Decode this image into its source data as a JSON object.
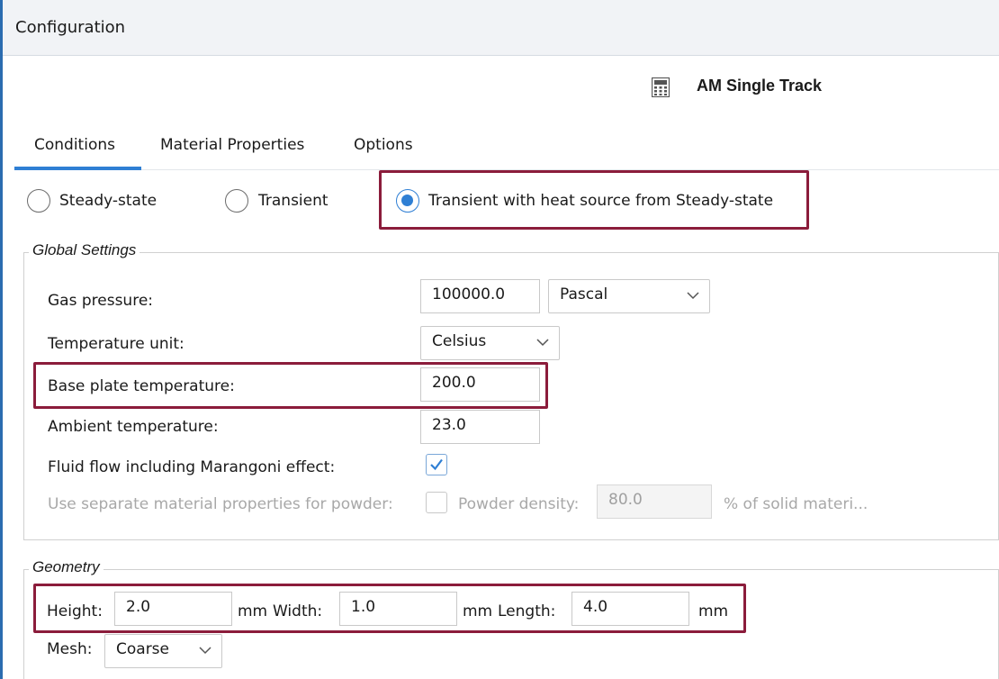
{
  "window": {
    "title": "Configuration"
  },
  "header": {
    "app_name": "AM Single Track",
    "icon": "calculator-icon"
  },
  "tabs": [
    {
      "label": "Conditions",
      "active": true
    },
    {
      "label": "Material Properties",
      "active": false
    },
    {
      "label": "Options",
      "active": false
    }
  ],
  "mode": {
    "options": [
      {
        "label": "Steady-state",
        "selected": false
      },
      {
        "label": "Transient",
        "selected": false
      },
      {
        "label": "Transient with heat source from Steady-state",
        "selected": true
      }
    ]
  },
  "global_settings": {
    "legend": "Global Settings",
    "gas_pressure": {
      "label": "Gas pressure:",
      "value": "100000.0",
      "unit": "Pascal"
    },
    "temperature_unit": {
      "label": "Temperature unit:",
      "value": "Celsius"
    },
    "base_plate_temperature": {
      "label": "Base plate temperature:",
      "value": "200.0"
    },
    "ambient_temperature": {
      "label": "Ambient temperature:",
      "value": "23.0"
    },
    "fluid_flow": {
      "label": "Fluid flow including Marangoni effect:",
      "checked": true
    },
    "separate_powder": {
      "label": "Use separate material properties for powder:",
      "checked": false
    },
    "powder_density": {
      "label": "Powder density:",
      "value": "80.0",
      "suffix": "% of solid materi..."
    }
  },
  "geometry": {
    "legend": "Geometry",
    "height": {
      "label": "Height:",
      "value": "2.0",
      "unit": "mm"
    },
    "width": {
      "label": "Width:",
      "value": "1.0",
      "unit": "mm"
    },
    "length": {
      "label": "Length:",
      "value": "4.0",
      "unit": "mm"
    },
    "mesh": {
      "label": "Mesh:",
      "value": "Coarse"
    }
  },
  "colors": {
    "accent": "#2f7fd4",
    "highlight": "#8b1c3b",
    "window_border": "#2b6cb0"
  }
}
